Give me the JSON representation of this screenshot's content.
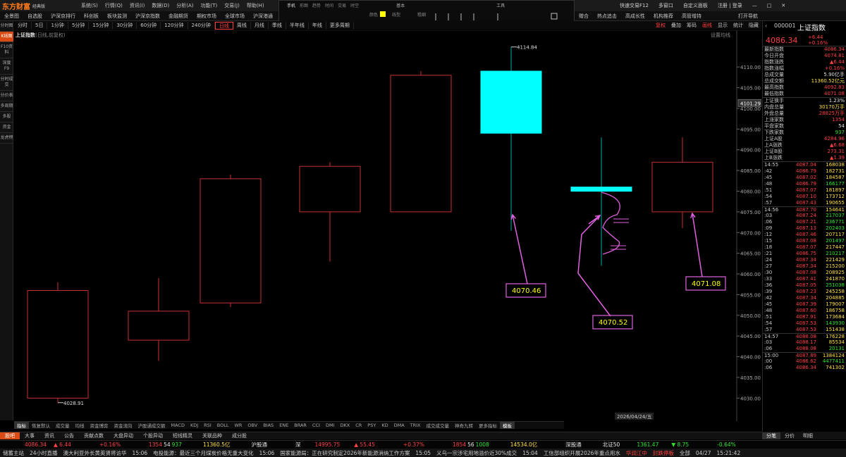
{
  "app": {
    "logo": "东方财富",
    "edition": "经典版"
  },
  "menu": [
    "系统(S)",
    "行情(Q)",
    "资讯(I)",
    "数据(D)",
    "分析(A)",
    "功能(T)",
    "交易(J)",
    "帮助(H)"
  ],
  "window_right": [
    "快速交易F12",
    "多窗口",
    "自定义面板",
    "注册 | 登录"
  ],
  "nav2": [
    "全景图",
    "自选股",
    "沪深京排行",
    "科创板",
    "板块监测",
    "沪深京指数",
    "金融期货",
    "期权市场",
    "全球市场",
    "沪深港通",
    "港股"
  ],
  "nav2_right": [
    "赠合",
    "热点追击",
    "高成长性",
    "机构推荐",
    "高管增持",
    "打开导航"
  ],
  "overlay": {
    "tabs": [
      "手机",
      "形图",
      "趋势",
      "时间",
      "交易",
      "时空"
    ],
    "panel1": "基本",
    "panel2": "工具",
    "colors_label": "颜色",
    "line_label": "线型",
    "thickness_label": "粗细"
  },
  "periods": [
    "分时",
    "5日",
    "1分钟",
    "5分钟",
    "15分钟",
    "30分钟",
    "60分钟",
    "120分钟",
    "240分钟",
    "日线",
    "周线",
    "月线",
    "季线",
    "半年线",
    "年线",
    "更多周期"
  ],
  "active_period": "日线",
  "tools_right": [
    "复权",
    "叠加",
    "筹码",
    "画线",
    "显示",
    "统计",
    "隐藏"
  ],
  "left_sidebar": [
    "分时图",
    "K线图",
    "F10资料",
    "深度F9",
    "分时成交",
    "分价表",
    "多周期",
    "多股",
    "资金",
    "龙虎榜"
  ],
  "chart_title": {
    "name": "上证指数",
    "sub": "(日线,前复权)"
  },
  "chart_settings": "设置均线",
  "chart_data": {
    "type": "candlestick",
    "ylim": [
      4027,
      4117
    ],
    "yticks": [
      4030,
      4035,
      4040,
      4045,
      4050,
      4055,
      4060,
      4065,
      4070,
      4075,
      4080,
      4085,
      4090,
      4095,
      4100,
      4105,
      4110
    ],
    "yticks_label": [
      "4030.00",
      "4035.00",
      "4040.00",
      "4045.00",
      "4050.00",
      "4055.00",
      "4060.00",
      "4065.00",
      "4070.00",
      "4075.00",
      "4080.00",
      "4085.00",
      "4090.00",
      "4095.00",
      "4100.00",
      "4105.00",
      "4110.00"
    ],
    "current_price_label": "4101.29",
    "current_price": 4101.29,
    "date_label": "2026/04/24/五",
    "candles": [
      {
        "open": 4056,
        "close": 4030,
        "high": 4058,
        "low": 4028.91,
        "color": "#ff3b3b",
        "filled": false
      },
      {
        "open": 4044,
        "close": 4051,
        "high": 4059,
        "low": 4039,
        "color": "#ff3b3b",
        "filled": false
      },
      {
        "open": 4053,
        "close": 4083,
        "high": 4084,
        "low": 4052,
        "color": "#ff3b3b",
        "filled": false
      },
      {
        "open": 4075,
        "close": 4086,
        "high": 4087,
        "low": 4063,
        "color": "#ff3b3b",
        "filled": false
      },
      {
        "open": 4075,
        "close": 4108,
        "high": 4109,
        "low": 4075,
        "color": "#ff3b3b",
        "filled": false
      },
      {
        "open": 4109,
        "close": 4094,
        "high": 4114.84,
        "low": 4070.46,
        "color": "#00ffff",
        "filled": true
      },
      {
        "open": 4081,
        "close": 4080,
        "high": 4093,
        "low": 4062,
        "color": "#00ffff",
        "filled": true
      },
      {
        "open": 4075,
        "close": 4087,
        "high": 4093,
        "low": 4071.08,
        "color": "#ff3b3b",
        "filled": false
      }
    ],
    "marker_high": "4114.84",
    "marker_low": "4028.91",
    "annotations": [
      "4070.46",
      "4070.52",
      "4071.08"
    ]
  },
  "indicator_tabs": [
    "指标",
    "恢复默认",
    "成交量",
    "均线",
    "资金博弈",
    "资金流向",
    "沪股通成交额",
    "MACD",
    "KDJ",
    "RSI",
    "BOLL",
    "WR",
    "OBV",
    "BIAS",
    "ENE",
    "BRAR",
    "CCI",
    "DMI",
    "DKX",
    "CR",
    "PSY",
    "KD",
    "DMA",
    "TRIX",
    "成交成交量",
    "神奇九转",
    "更多指标",
    "模板"
  ],
  "right_panel": {
    "code": "000001",
    "name": "上证指数",
    "price": "4086.34",
    "change": "+6.44",
    "change_pct": "+0.16%",
    "stats": [
      {
        "k": "最新指数",
        "v": "4086.34",
        "c": "r"
      },
      {
        "k": "今日开盘",
        "v": "4074.81",
        "c": "r"
      },
      {
        "k": "指数涨跌",
        "v": "▲6.44",
        "c": "r"
      },
      {
        "k": "指数涨幅",
        "v": "+0.16%",
        "c": "r"
      },
      {
        "k": "总成交量",
        "v": "5.90亿手",
        "c": "w"
      },
      {
        "k": "总成交额",
        "v": "11360.52亿元",
        "c": "y"
      },
      {
        "k": "最高指数",
        "v": "4092.83",
        "c": "r"
      },
      {
        "k": "最低指数",
        "v": "4071.08",
        "c": "r"
      }
    ],
    "stats2": [
      {
        "k": "上证换手",
        "v": "1.23%",
        "c": "w"
      },
      {
        "k": "内盘总量",
        "v": "30170万手",
        "c": "y"
      },
      {
        "k": "外盘总量",
        "v": "28825万手",
        "c": "r"
      },
      {
        "k": "上涨家数",
        "v": "1354",
        "c": "r"
      },
      {
        "k": "平盘家数",
        "v": "54",
        "c": "w"
      },
      {
        "k": "下跌家数",
        "v": "937",
        "c": "g"
      },
      {
        "k": "上证A股",
        "v": "4284.96",
        "c": "r"
      },
      {
        "k": "上A涨跌",
        "v": "▲6.68",
        "c": "r"
      },
      {
        "k": "上证B股",
        "v": "273.31",
        "c": "r"
      },
      {
        "k": "上B涨跌",
        "v": "▲1.39",
        "c": "r"
      }
    ],
    "ticks": [
      {
        "t": "14:55",
        "p": "4087.04",
        "v": "168038",
        "g": false
      },
      {
        "t": ":42",
        "p": "4086.79",
        "v": "182731",
        "g": false
      },
      {
        "t": ":45",
        "p": "4087.02",
        "v": "184587",
        "g": false
      },
      {
        "t": ":48",
        "p": "4086.79",
        "v": "166177",
        "g": true
      },
      {
        "t": ":51",
        "p": "4087.07",
        "v": "181897",
        "g": false
      },
      {
        "t": ":54",
        "p": "4087.10",
        "v": "173712",
        "g": false
      },
      {
        "t": ":57",
        "p": "4087.43",
        "v": "190655",
        "g": false
      },
      {
        "t": "14:56",
        "p": "4087.70",
        "v": "154641",
        "g": false
      },
      {
        "t": ":03",
        "p": "4087.24",
        "v": "217037",
        "g": true
      },
      {
        "t": ":06",
        "p": "4087.21",
        "v": "236771",
        "g": true
      },
      {
        "t": ":09",
        "p": "4087.13",
        "v": "202403",
        "g": true
      },
      {
        "t": ":12",
        "p": "4087.46",
        "v": "207117",
        "g": false
      },
      {
        "t": ":15",
        "p": "4087.08",
        "v": "201497",
        "g": true
      },
      {
        "t": ":18",
        "p": "4087.07",
        "v": "217447",
        "g": false
      },
      {
        "t": ":21",
        "p": "4086.75",
        "v": "210217",
        "g": true
      },
      {
        "t": ":24",
        "p": "4087.34",
        "v": "221429",
        "g": false
      },
      {
        "t": ":27",
        "p": "4087.34",
        "v": "215200",
        "g": false
      },
      {
        "t": ":30",
        "p": "4087.08",
        "v": "208925",
        "g": false
      },
      {
        "t": ":33",
        "p": "4087.41",
        "v": "241870",
        "g": false
      },
      {
        "t": ":36",
        "p": "4087.05",
        "v": "251038",
        "g": true
      },
      {
        "t": ":39",
        "p": "4087.23",
        "v": "245258",
        "g": false
      },
      {
        "t": ":42",
        "p": "4087.34",
        "v": "204885",
        "g": false
      },
      {
        "t": ":45",
        "p": "4087.39",
        "v": "179007",
        "g": false
      },
      {
        "t": ":48",
        "p": "4087.60",
        "v": "186758",
        "g": false
      },
      {
        "t": ":51",
        "p": "4087.91",
        "v": "173684",
        "g": false
      },
      {
        "t": ":54",
        "p": "4087.53",
        "v": "143930",
        "g": true
      },
      {
        "t": ":57",
        "p": "4087.53",
        "v": "151438",
        "g": false
      },
      {
        "t": "14:57",
        "p": "4088.08",
        "v": "176228",
        "g": false
      },
      {
        "t": ":03",
        "p": "4088.17",
        "v": "85534",
        "g": false
      },
      {
        "t": ":06",
        "p": "4088.08",
        "v": "20131",
        "g": true
      },
      {
        "t": "15:00",
        "p": "4087.89",
        "v": "1384124",
        "g": false
      },
      {
        "t": ":00",
        "p": "4086.62",
        "v": "4477411",
        "g": true
      },
      {
        "t": ":06",
        "p": "4086.34",
        "v": "741302",
        "g": false
      }
    ],
    "tabs": [
      "分笔",
      "分价",
      "明细"
    ]
  },
  "news_tabs": [
    "股吧",
    "大事",
    "资讯",
    "公告",
    "贡献点数",
    "大盘异动",
    "个股异动",
    "短线精灵",
    "关联品种",
    "成分股"
  ],
  "index_bar": {
    "a_price": "4086.34",
    "a_chg": "▲ 6.44",
    "a_pct": "+0.16%",
    "a_up": "1354",
    "a_flat": "54",
    "a_down": "937",
    "a_amt": "11360.5亿",
    "hgt_label": "沪股通",
    "sz_label": "深",
    "sz_price": "14995.75",
    "sz_chg": "▲ 55.45",
    "sz_pct": "+0.37%",
    "sz_up": "1854",
    "sz_flat": "56",
    "sz_down": "1008",
    "sz_amt": "14534.0亿",
    "sgt_label": "深股通",
    "bz_label": "北证50",
    "bz_price": "1361.47",
    "bz_chg": "▼ 8.75",
    "bz_pct": "-0.64%"
  },
  "ticker": [
    "储蓄主站",
    "24小时直播",
    "澳大利亚外长黄英贤将访华",
    "15:06",
    "电投能源：最近三个月煤炭价格无重大变化",
    "15:06",
    "国家能源局：正在研究制定2026年新能源消纳工作方案",
    "15:05",
    "义乌一宗涉宅用地溢价近30%成交",
    "15:04",
    "工信部组织开展2026年重点用水",
    "华润江中",
    "封跌停板",
    "全部",
    "04/27",
    "15:21:42"
  ]
}
